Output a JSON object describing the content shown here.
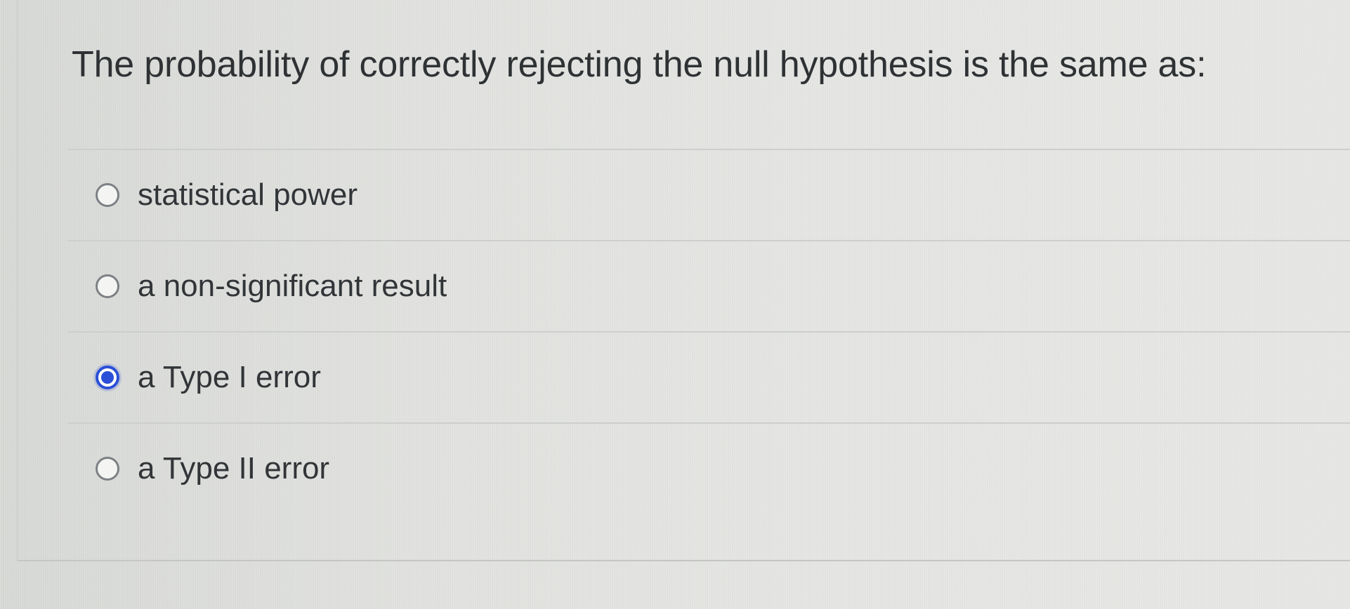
{
  "question": {
    "text": "The probability of correctly rejecting the null hypothesis is the same as:"
  },
  "options": [
    {
      "label": "statistical power",
      "selected": false
    },
    {
      "label": "a non-significant result",
      "selected": false
    },
    {
      "label": "a Type I error",
      "selected": true
    },
    {
      "label": "a Type II error",
      "selected": false
    }
  ],
  "colors": {
    "selected_radio": "#2b4fd6",
    "text": "#323538",
    "background": "#e2e3e0"
  },
  "icons": {
    "unselected": "radio-unchecked-icon",
    "selected": "radio-checked-icon"
  }
}
